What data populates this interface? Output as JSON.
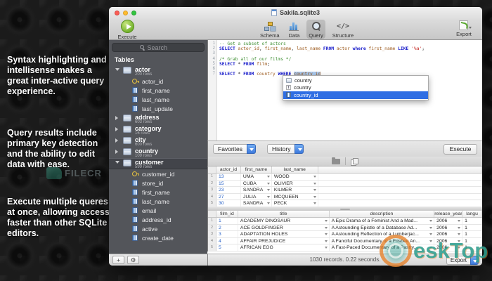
{
  "desktop": {
    "marketing": [
      "Syntax highlighting and intellisense makes a great inter-active query experience.",
      "Query results include primary key detection and the ability to edit data with ease.",
      "Execute multiple queres at once, allowing access faster than other SQLite editors."
    ],
    "filecr_watermark": "FILECR",
    "desktop_watermark": "eskTop"
  },
  "window": {
    "title": "Sakila.sqlite3",
    "toolbar": {
      "execute_label": "Execute",
      "export_label": "Export",
      "tabs": [
        {
          "label": "Schema",
          "icon": "schema",
          "selected": false
        },
        {
          "label": "Data",
          "icon": "data",
          "selected": false
        },
        {
          "label": "Query",
          "icon": "query",
          "selected": true
        },
        {
          "label": "Structure",
          "icon": "structure",
          "glyph": "</>",
          "selected": false
        }
      ]
    },
    "sidebar": {
      "search_placeholder": "Search",
      "section_title": "Tables",
      "tree": [
        {
          "name": "actor",
          "rows": "200 rows",
          "expanded": true,
          "selected": false,
          "columns": [
            {
              "name": "actor_id",
              "key": true
            },
            {
              "name": "first_name",
              "key": false
            },
            {
              "name": "last_name",
              "key": false
            },
            {
              "name": "last_update",
              "key": false
            }
          ]
        },
        {
          "name": "address",
          "rows": "603 rows",
          "expanded": false,
          "selected": false,
          "columns": []
        },
        {
          "name": "category",
          "rows": "16 rows",
          "expanded": false,
          "selected": false,
          "columns": []
        },
        {
          "name": "city",
          "rows": "600 rows",
          "expanded": false,
          "selected": false,
          "columns": []
        },
        {
          "name": "country",
          "rows": "109 rows",
          "expanded": false,
          "selected": false,
          "columns": []
        },
        {
          "name": "customer",
          "rows": "599 rows",
          "expanded": true,
          "selected": true,
          "columns": [
            {
              "name": "customer_id",
              "key": true
            },
            {
              "name": "store_id",
              "key": false
            },
            {
              "name": "first_name",
              "key": false
            },
            {
              "name": "last_name",
              "key": false
            },
            {
              "name": "email",
              "key": false
            },
            {
              "name": "address_id",
              "key": false
            },
            {
              "name": "active",
              "key": false
            },
            {
              "name": "create_date",
              "key": false
            }
          ]
        }
      ],
      "add_button": "+",
      "gear_button": "⚙"
    },
    "editor": {
      "lines": [
        {
          "num": "1",
          "segments": [
            {
              "text": "-- Get a subset of actors",
              "cls": "cm"
            }
          ]
        },
        {
          "num": "2",
          "segments": [
            {
              "text": "SELECT",
              "cls": "kw"
            },
            {
              "text": " ",
              "cls": ""
            },
            {
              "text": "actor_id",
              "cls": "id"
            },
            {
              "text": ", ",
              "cls": ""
            },
            {
              "text": "first_name",
              "cls": "id"
            },
            {
              "text": ", ",
              "cls": ""
            },
            {
              "text": "last_name",
              "cls": "id"
            },
            {
              "text": " ",
              "cls": ""
            },
            {
              "text": "FROM",
              "cls": "kw"
            },
            {
              "text": " ",
              "cls": ""
            },
            {
              "text": "actor",
              "cls": "id"
            },
            {
              "text": " ",
              "cls": ""
            },
            {
              "text": "where",
              "cls": "kw"
            },
            {
              "text": " ",
              "cls": ""
            },
            {
              "text": "first_name",
              "cls": "id"
            },
            {
              "text": " ",
              "cls": ""
            },
            {
              "text": "LIKE",
              "cls": "kw"
            },
            {
              "text": " ",
              "cls": ""
            },
            {
              "text": "'%a'",
              "cls": "str"
            },
            {
              "text": ";",
              "cls": ""
            }
          ]
        },
        {
          "num": "3",
          "segments": []
        },
        {
          "num": "4",
          "segments": [
            {
              "text": "/* Grab all of our films */",
              "cls": "cm"
            }
          ]
        },
        {
          "num": "5",
          "segments": [
            {
              "text": "SELECT",
              "cls": "kw"
            },
            {
              "text": " * ",
              "cls": ""
            },
            {
              "text": "FROM",
              "cls": "kw"
            },
            {
              "text": " ",
              "cls": ""
            },
            {
              "text": "film",
              "cls": "id"
            },
            {
              "text": ";",
              "cls": ""
            }
          ]
        },
        {
          "num": "6",
          "segments": []
        },
        {
          "num": "7",
          "segments": [
            {
              "text": "SELECT",
              "cls": "kw"
            },
            {
              "text": " * ",
              "cls": ""
            },
            {
              "text": "FROM",
              "cls": "kw"
            },
            {
              "text": " ",
              "cls": ""
            },
            {
              "text": "country",
              "cls": "id"
            },
            {
              "text": " ",
              "cls": ""
            },
            {
              "text": "WHERE",
              "cls": "kw"
            },
            {
              "text": " ",
              "cls": ""
            },
            {
              "text": "country_id",
              "cls": "id hl"
            }
          ]
        }
      ],
      "autocomplete": [
        {
          "label": "country",
          "icon": "table",
          "glyph": "",
          "selected": false
        },
        {
          "label": "country",
          "icon": "text",
          "glyph": "T",
          "selected": false
        },
        {
          "label": "country_id",
          "icon": "column",
          "glyph": "",
          "selected": true
        }
      ]
    },
    "querybar": {
      "favorites_label": "Favorites",
      "history_label": "History",
      "execute_label": "Execute"
    },
    "results": [
      {
        "columns": [
          "actor_id",
          "first_name",
          "last_name",
          ""
        ],
        "rows": [
          [
            "13",
            "UMA",
            "WOOD",
            ""
          ],
          [
            "15",
            "CUBA",
            "OLIVIER",
            ""
          ],
          [
            "23",
            "SANDRA",
            "KILMER",
            ""
          ],
          [
            "27",
            "JULIA",
            "MCQUEEN",
            ""
          ],
          [
            "30",
            "SANDRA",
            "PECK",
            ""
          ]
        ]
      },
      {
        "columns": [
          "film_id",
          "title",
          "description",
          "release_year",
          "langu"
        ],
        "rows": [
          [
            "1",
            "ACADEMY DINOSAUR",
            "A Epic Drama of a Feminist And a Mad...",
            "2006",
            "1"
          ],
          [
            "2",
            "ACE GOLDFINGER",
            "A Astounding Epistle of a Database Ad...",
            "2006",
            "1"
          ],
          [
            "3",
            "ADAPTATION HOLES",
            "A Astounding Reflection of a Lumberjac...",
            "2006",
            "1"
          ],
          [
            "4",
            "AFFAIR PREJUDICE",
            "A Fanciful Documentary of a Frisbee An...",
            "2006",
            "1"
          ],
          [
            "5",
            "AFRICAN EGG",
            "A Fast-Paced Documentary of a Pastry...",
            "2006",
            "1"
          ]
        ]
      }
    ],
    "statusbar": {
      "text": "1030 records. 0.22 seconds.",
      "export_label": "Export"
    },
    "colors": {
      "keyword": "#1417c9",
      "identifier": "#9c5a1d",
      "comment": "#3f8f33",
      "string": "#c21f1a",
      "primary_key_value": "#2a63c8",
      "selection": "#2f6ee3",
      "sidebar": "#53555a"
    }
  }
}
